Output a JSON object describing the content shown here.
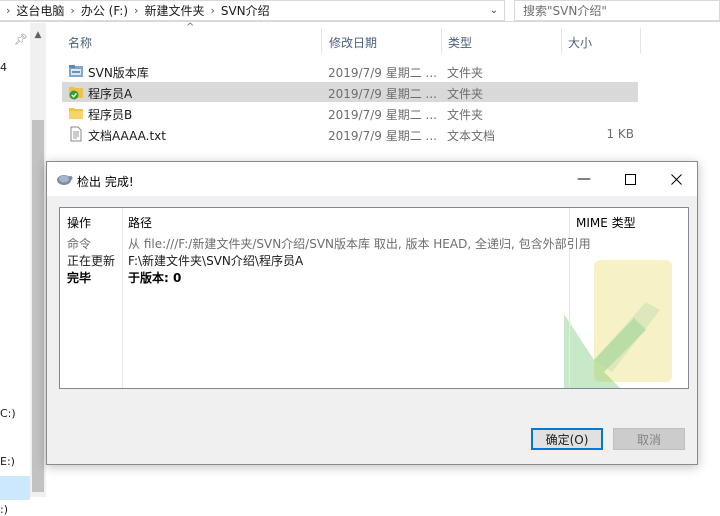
{
  "address": {
    "breadcrumbs": [
      "这台电脑",
      "办公 (F:)",
      "新建文件夹",
      "SVN介绍"
    ],
    "search_placeholder": "搜索\"SVN介绍\""
  },
  "nav": {
    "fragments": [
      "4",
      "C:)",
      "E:)",
      ":)"
    ]
  },
  "columns": {
    "name": "名称",
    "date": "修改日期",
    "type": "类型",
    "size": "大小"
  },
  "files": [
    {
      "name": "SVN版本库",
      "date": "2019/7/9 星期二 ...",
      "type": "文件夹",
      "size": "",
      "icon": "svn-repo-folder-icon"
    },
    {
      "name": "程序员A",
      "date": "2019/7/9 星期二 ...",
      "type": "文件夹",
      "size": "",
      "icon": "svn-checked-folder-icon",
      "selected": true
    },
    {
      "name": "程序员B",
      "date": "2019/7/9 星期二 ...",
      "type": "文件夹",
      "size": "",
      "icon": "folder-icon"
    },
    {
      "name": "文档AAAA.txt",
      "date": "2019/7/9 星期二 ...",
      "type": "文本文档",
      "size": "1 KB",
      "icon": "text-file-icon"
    }
  ],
  "dialog": {
    "title": "检出 完成!",
    "list_headers": {
      "action": "操作",
      "path": "路径",
      "mime": "MIME 类型"
    },
    "rows": [
      {
        "action": "命令",
        "path": "从 file:///F:/新建文件夹/SVN介绍/SVN版本库 取出, 版本 HEAD, 全递归, 包含外部引用",
        "style": "gray"
      },
      {
        "action": "正在更新",
        "path": "F:\\新建文件夹\\SVN介绍\\程序员A",
        "style": "normal"
      },
      {
        "action": "完毕",
        "path": "于版本: 0",
        "style": "bold"
      }
    ],
    "ok_label": "确定(O)",
    "cancel_label": "取消"
  },
  "colors": {
    "selection": "#d9d9d9",
    "header_text": "#4c607a",
    "accent": "#0078d7",
    "watermark_green": "#5fbf5f",
    "watermark_yellow": "#f5efb8"
  }
}
